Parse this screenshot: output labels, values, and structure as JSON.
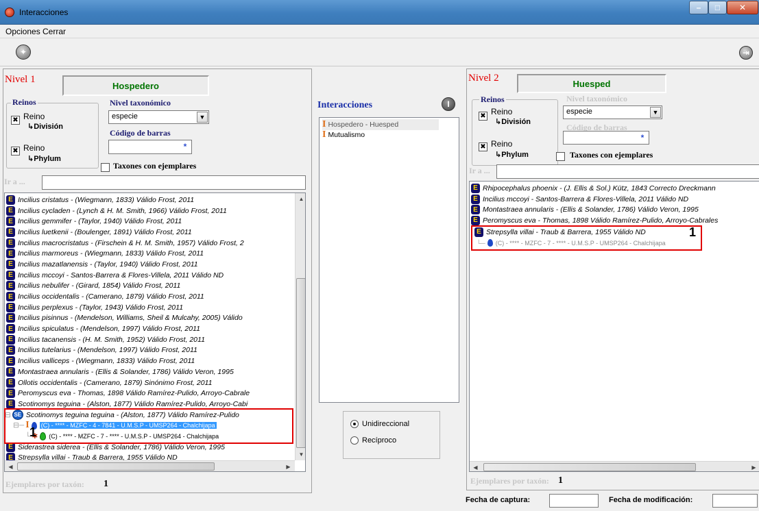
{
  "window": {
    "title": "Interacciones"
  },
  "menu": {
    "opciones": "Opciones",
    "cerrar": "Cerrar"
  },
  "left": {
    "nivel": "Nivel 1",
    "role": "Hospedero",
    "reinos_title": "Reinos",
    "reino1": "Reino",
    "reino1_sub": "División",
    "reino2": "Reino",
    "reino2_sub": "Phylum",
    "nivel_taxonomico_label": "Nivel taxonómico",
    "nivel_taxonomico_value": "especie",
    "codigo_barras_label": "Código de barras",
    "taxones_label": "Taxones con ejemplares",
    "ir_a_label": "Ir a ...",
    "items": [
      "Incilius cristatus - (Wiegmann, 1833)  Válido  Frost, 2011",
      "Incilius cycladen - (Lynch & H. M. Smith, 1966)  Válido  Frost, 2011",
      "Incilius gemmifer - (Taylor, 1940)  Válido  Frost, 2011",
      "Incilius luetkenii - (Boulenger, 1891)  Válido  Frost, 2011",
      "Incilius macrocristatus - (Firschein & H. M. Smith, 1957)  Válido  Frost, 2",
      "Incilius marmoreus - (Wiegmann, 1833)  Válido  Frost, 2011",
      "Incilius mazatlanensis - (Taylor, 1940)  Válido  Frost, 2011",
      "Incilius mccoyi - Santos-Barrera & Flores-Villela, 2011  Válido  ND",
      "Incilius nebulifer - (Girard, 1854)  Válido  Frost, 2011",
      "Incilius occidentalis - (Camerano, 1879)  Válido  Frost, 2011",
      "Incilius perplexus - (Taylor, 1943)  Válido  Frost, 2011",
      "Incilius pisinnus - (Mendelson, Williams, Sheil & Mulcahy, 2005)  Válido",
      "Incilius spiculatus - (Mendelson, 1997)  Válido  Frost, 2011",
      "Incilius tacanensis - (H. M. Smith, 1952)  Válido  Frost, 2011",
      "Incilius tutelarius - (Mendelson, 1997)  Válido  Frost, 2011",
      "Incilius valliceps - (Wiegmann, 1833)  Válido  Frost, 2011",
      "Montastraea annularis - (Ellis & Solander, 1786)  Válido  Veron, 1995",
      "Ollotis occidentalis - (Camerano, 1879)  Sinónimo   Frost, 2011",
      "Peromyscus eva - Thomas, 1898  Válido  Ramírez-Pulido, Arroyo-Cabrale",
      "Scotinomys teguina - (Alston, 1877)  Válido  Ramírez-Pulido, Arroyo-Cabi"
    ],
    "subspecies": "Scotinomys teguina teguina - (Alston, 1877)  Válido  Ramírez-Pulido",
    "specimen1": "(C) - **** - MZFC -  4 - 7841 - U.M.S.P - UMSP264 - Chalchijapa",
    "specimen2": "(C) - **** - MZFC -  7 - **** - U.M.S.P - UMSP264 - Chalchijapa",
    "items_after": [
      "Siderastrea siderea - (Ellis & Solander, 1786)  Válido  Veron, 1995",
      "Strepsylla villai - Traub & Barrera, 1955  Válido  ND"
    ],
    "marker": "1",
    "ejemplares_label": "Ejemplares por taxón:",
    "ejemplares_value": "1"
  },
  "center": {
    "title": "Interacciones",
    "items": [
      "Hospedero - Huesped",
      "Mutualismo"
    ],
    "radio1": "Unidireccional",
    "radio2": "Recíproco"
  },
  "right": {
    "nivel": "Nivel 2",
    "role": "Huesped",
    "reinos_title": "Reinos",
    "reino1": "Reino",
    "reino1_sub": "División",
    "reino2": "Reino",
    "reino2_sub": "Phylum",
    "nivel_taxonomico_label": "Nivel taxonómico",
    "nivel_taxonomico_value": "especie",
    "codigo_barras_label": "Código de barras",
    "taxones_label": "Taxones con ejemplares",
    "ir_a_label": "Ir a ...",
    "items": [
      "Rhipocephalus phoenix - (J. Ellis & Sol.) Kütz, 1843  Correcto   Dreckmann",
      "Incilius mccoyi - Santos-Barrera & Flores-Villela, 2011  Válido  ND",
      "Montastraea annularis - (Ellis & Solander, 1786)  Válido  Veron, 1995",
      "Peromyscus eva - Thomas, 1898  Válido  Ramírez-Pulido, Arroyo-Cabrales"
    ],
    "highlight_item": "Strepsylla villai - Traub & Barrera, 1955  Válido  ND",
    "specimen": "(C) - **** - MZFC -  7 - **** - U.M.S.P - UMSP264 - Chalchijapa",
    "marker": "1",
    "ejemplares_label": "Ejemplares por taxón:",
    "ejemplares_value": "1"
  },
  "footer": {
    "fecha_captura": "Fecha de captura:",
    "fecha_modificacion": "Fecha de modificación:"
  },
  "icons": {
    "check": "✖",
    "e": "E",
    "se": "SE",
    "ibeam": "I",
    "star": "*",
    "arrow": "↳"
  }
}
